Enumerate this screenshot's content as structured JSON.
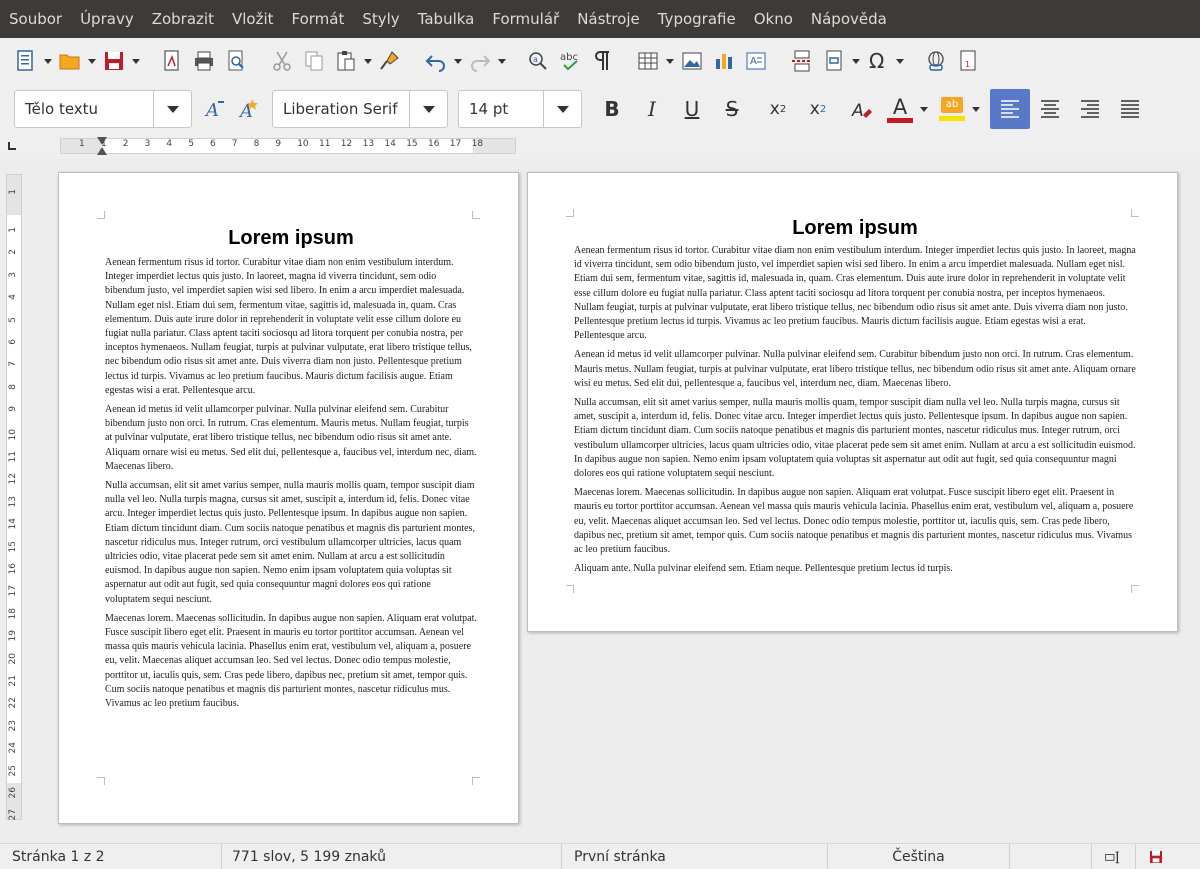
{
  "menu": [
    "Soubor",
    "Úpravy",
    "Zobrazit",
    "Vložit",
    "Formát",
    "Styly",
    "Tabulka",
    "Formulář",
    "Nástroje",
    "Typografie",
    "Okno",
    "Nápověda"
  ],
  "toolbar2": {
    "paragraph_style": "Tělo textu",
    "font_name": "Liberation Serif",
    "font_size": "14 pt"
  },
  "ruler": {
    "h_numbers": [
      "1",
      "1",
      "2",
      "3",
      "4",
      "5",
      "6",
      "7",
      "8",
      "9",
      "10",
      "11",
      "12",
      "13",
      "14",
      "15",
      "16",
      "17",
      "18"
    ],
    "v_numbers": [
      "1",
      "1",
      "2",
      "3",
      "4",
      "5",
      "6",
      "7",
      "8",
      "9",
      "10",
      "11",
      "12",
      "13",
      "14",
      "15",
      "16",
      "17",
      "18",
      "19",
      "20",
      "21",
      "22",
      "23",
      "24",
      "25",
      "26",
      "27"
    ]
  },
  "document": {
    "title": "Lorem ipsum",
    "paragraphs": [
      "Aenean fermentum risus id tortor. Curabitur vitae diam non enim vestibulum interdum. Integer imperdiet lectus quis justo. In laoreet, magna id viverra tincidunt, sem odio bibendum justo, vel imperdiet sapien wisi sed libero. In enim a arcu imperdiet malesuada. Nullam eget nisl. Etiam dui sem, fermentum vitae, sagittis id, malesuada in, quam. Cras elementum. Duis aute irure dolor in reprehenderit in voluptate velit esse cillum dolore eu fugiat nulla pariatur. Class aptent taciti sociosqu ad litora torquent per conubia nostra, per inceptos hymenaeos. Nullam feugiat, turpis at pulvinar vulputate, erat libero tristique tellus, nec bibendum odio risus sit amet ante. Duis viverra diam non justo. Pellentesque pretium lectus id turpis. Vivamus ac leo pretium faucibus. Mauris dictum facilisis augue. Etiam egestas wisi a erat. Pellentesque arcu.",
      "Aenean id metus id velit ullamcorper pulvinar. Nulla pulvinar eleifend sem. Curabitur bibendum justo non orci. In rutrum. Cras elementum. Mauris metus. Nullam feugiat, turpis at pulvinar vulputate, erat libero tristique tellus, nec bibendum odio risus sit amet ante. Aliquam ornare wisi eu metus. Sed elit dui, pellentesque a, faucibus vel, interdum nec, diam. Maecenas libero.",
      "Nulla accumsan, elit sit amet varius semper, nulla mauris mollis quam, tempor suscipit diam nulla vel leo. Nulla turpis magna, cursus sit amet, suscipit a, interdum id, felis. Donec vitae arcu. Integer imperdiet lectus quis justo. Pellentesque ipsum. In dapibus augue non sapien. Etiam dictum tincidunt diam. Cum sociis natoque penatibus et magnis dis parturient montes, nascetur ridiculus mus. Integer rutrum, orci vestibulum ullamcorper ultricies, lacus quam ultricies odio, vitae placerat pede sem sit amet enim. Nullam at arcu a est sollicitudin euismod. In dapibus augue non sapien. Nemo enim ipsam voluptatem quia voluptas sit aspernatur aut odit aut fugit, sed quia consequuntur magni dolores eos qui ratione voluptatem sequi nesciunt.",
      "Maecenas lorem. Maecenas sollicitudin. In dapibus augue non sapien. Aliquam erat volutpat. Fusce suscipit libero eget elit. Praesent in mauris eu tortor porttitor accumsan. Aenean vel massa quis mauris vehicula lacinia. Phasellus enim erat, vestibulum vel, aliquam a, posuere eu, velit. Maecenas aliquet accumsan leo. Sed vel lectus. Donec odio tempus molestie, porttitor ut, iaculis quis, sem. Cras pede libero, dapibus nec, pretium sit amet, tempor quis. Cum sociis natoque penatibus et magnis dis parturient montes, nascetur ridiculus mus. Vivamus ac leo pretium faucibus.",
      "Aliquam ante. Nulla pulvinar eleifend sem. Etiam neque. Pellentesque pretium lectus id turpis."
    ]
  },
  "status": {
    "page": "Stránka 1 z 2",
    "words": "771 slov, 5 199 znaků",
    "page_style": "První stránka",
    "language": "Čeština"
  },
  "colors": {
    "menubar": "#3c3b37",
    "font_color": "#c01c28",
    "highlight": "#f5e400",
    "active_align": "#5a78c8"
  }
}
